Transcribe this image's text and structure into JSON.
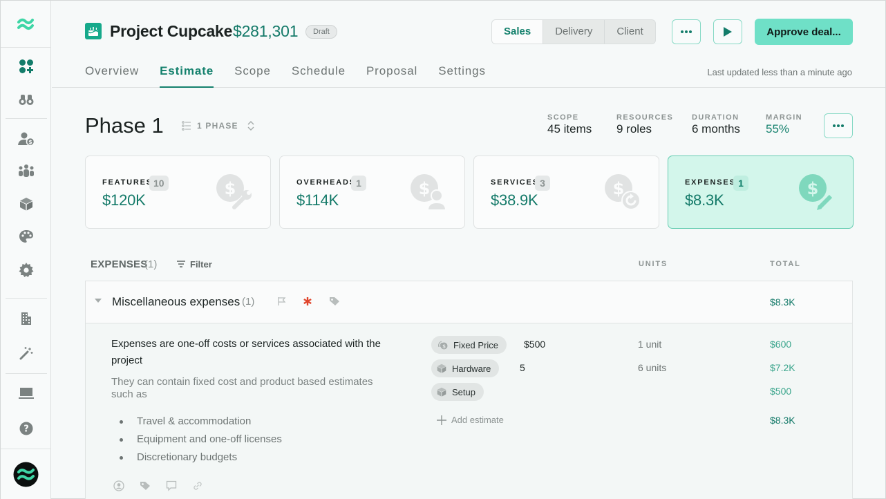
{
  "sidebar": {
    "logo_icon": "wave-logo-icon",
    "items": [
      {
        "name": "dashboard",
        "icon": "apps-add-icon",
        "active": true
      },
      {
        "name": "explore",
        "icon": "binoculars-icon"
      },
      {
        "name": "clients",
        "icon": "user-dollar-icon"
      },
      {
        "name": "team",
        "icon": "team-icon"
      },
      {
        "name": "products",
        "icon": "cube-icon"
      },
      {
        "name": "themes",
        "icon": "palette-icon"
      },
      {
        "name": "settings",
        "icon": "gear-icon"
      },
      {
        "name": "company",
        "icon": "building-icon"
      },
      {
        "name": "magic",
        "icon": "magic-wand-icon"
      },
      {
        "name": "devices",
        "icon": "laptop-icon"
      },
      {
        "name": "help",
        "icon": "help-icon"
      }
    ],
    "avatar_icon": "brand-avatar-icon"
  },
  "header": {
    "project_icon": "cake-icon",
    "title": "Project Cupcake",
    "amount": "$281,301",
    "status_badge": "Draft",
    "view_toggle": [
      {
        "label": "Sales",
        "active": true
      },
      {
        "label": "Delivery",
        "active": false
      },
      {
        "label": "Client",
        "active": false
      }
    ],
    "more_icon": "more-horizontal-icon",
    "play_icon": "play-icon",
    "approve_label": "Approve deal...",
    "tabs": [
      {
        "label": "Overview",
        "active": false
      },
      {
        "label": "Estimate",
        "active": true
      },
      {
        "label": "Scope",
        "active": false
      },
      {
        "label": "Schedule",
        "active": false
      },
      {
        "label": "Proposal",
        "active": false
      },
      {
        "label": "Settings",
        "active": false
      }
    ],
    "last_updated": "Last updated less than a minute ago"
  },
  "phase": {
    "title": "Phase 1",
    "selector_label": "1 PHASE",
    "stats": [
      {
        "label": "SCOPE",
        "value": "45 items"
      },
      {
        "label": "RESOURCES",
        "value": "9 roles"
      },
      {
        "label": "DURATION",
        "value": "6 months"
      },
      {
        "label": "MARGIN",
        "value": "55%"
      }
    ]
  },
  "cards": [
    {
      "label": "FEATURES",
      "count": "10",
      "value": "$120K",
      "icon": "dollar-wrench-icon",
      "active": false
    },
    {
      "label": "OVERHEADS",
      "count": "1",
      "value": "$114K",
      "icon": "dollar-person-icon",
      "active": false
    },
    {
      "label": "SERVICES",
      "count": "3",
      "value": "$38.9K",
      "icon": "dollar-refresh-icon",
      "active": false
    },
    {
      "label": "EXPENSES",
      "count": "1",
      "value": "$8.3K",
      "icon": "dollar-pencil-icon",
      "active": true
    }
  ],
  "expenses": {
    "title": "EXPENSES",
    "count": "(1)",
    "filter_label": "Filter",
    "columns": {
      "units": "UNITS",
      "total": "TOTAL"
    },
    "group": {
      "name": "Miscellaneous expenses",
      "count": "(1)",
      "total": "$8.3K",
      "description": "Expenses are one-off costs or services associated with the project",
      "sub_description": "They can contain fixed cost and product based estimates such as",
      "bullets": [
        "Travel & accommodation",
        "Equipment and one-off licenses",
        "Discretionary budgets"
      ],
      "estimates": [
        {
          "chip": "Fixed Price",
          "chip_icon": "coins-icon",
          "value": "$500",
          "units": "1 unit",
          "total": "$600"
        },
        {
          "chip": "Hardware",
          "chip_icon": "cube-icon",
          "value": "5",
          "units": "6 units",
          "total": "$7.2K"
        },
        {
          "chip": "Setup",
          "chip_icon": "cube-icon",
          "value": "",
          "units": "",
          "total": "$500"
        }
      ],
      "add_estimate_label": "Add estimate",
      "estimates_total": "$8.3K"
    }
  },
  "colors": {
    "accent": "#147a69",
    "accent_light": "#6fe0c7",
    "active_card_bg": "#d3f6eb",
    "required_mark": "#e0452c"
  }
}
